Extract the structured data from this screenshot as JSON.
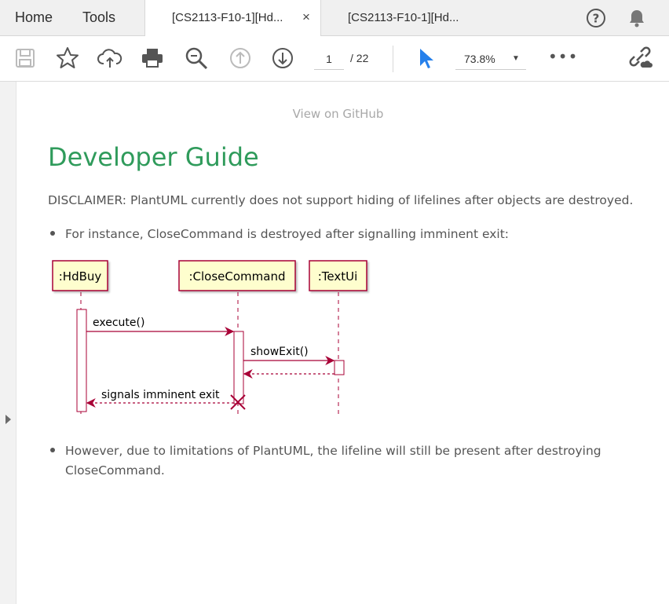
{
  "nav": {
    "home": "Home",
    "tools": "Tools"
  },
  "tabs": [
    {
      "label": "[CS2113-F10-1][Hd...",
      "close": "×",
      "active": true
    },
    {
      "label": "[CS2113-F10-1][Hd...",
      "active": false
    }
  ],
  "toolbar": {
    "icons": [
      "save-icon",
      "bookmark-star-icon",
      "upload-cloud-icon",
      "print-icon",
      "zoom-search-icon",
      "page-up-icon",
      "page-down-icon",
      "select-cursor-icon",
      "more-icon",
      "share-link-icon",
      "help-icon",
      "notification-bell-icon"
    ],
    "page_current": "1",
    "page_total": "/ 22",
    "zoom": "73.8%",
    "more": "•••"
  },
  "document": {
    "github_link": "View on GitHub",
    "title": "Developer Guide",
    "disclaimer": "DISCLAIMER: PlantUML currently does not support hiding of lifelines after objects are destroyed.",
    "bullet1": "For instance, CloseCommand is destroyed after signalling imminent exit:",
    "bullet2_line1": "However, due to limitations of PlantUML, the lifeline will still be present after destroying",
    "bullet2_line2": "CloseCommand."
  },
  "diagram": {
    "participants": [
      ":HdBuy",
      ":CloseCommand",
      ":TextUi"
    ],
    "messages": [
      "execute()",
      "showExit()",
      "signals imminent exit"
    ],
    "colors": {
      "box_fill": "#FEFECE",
      "border": "#A80036",
      "arrow": "#A80036"
    }
  },
  "colors": {
    "title": "#2f9b5b",
    "text": "#555555",
    "accent_cursor": "#2680eb"
  }
}
